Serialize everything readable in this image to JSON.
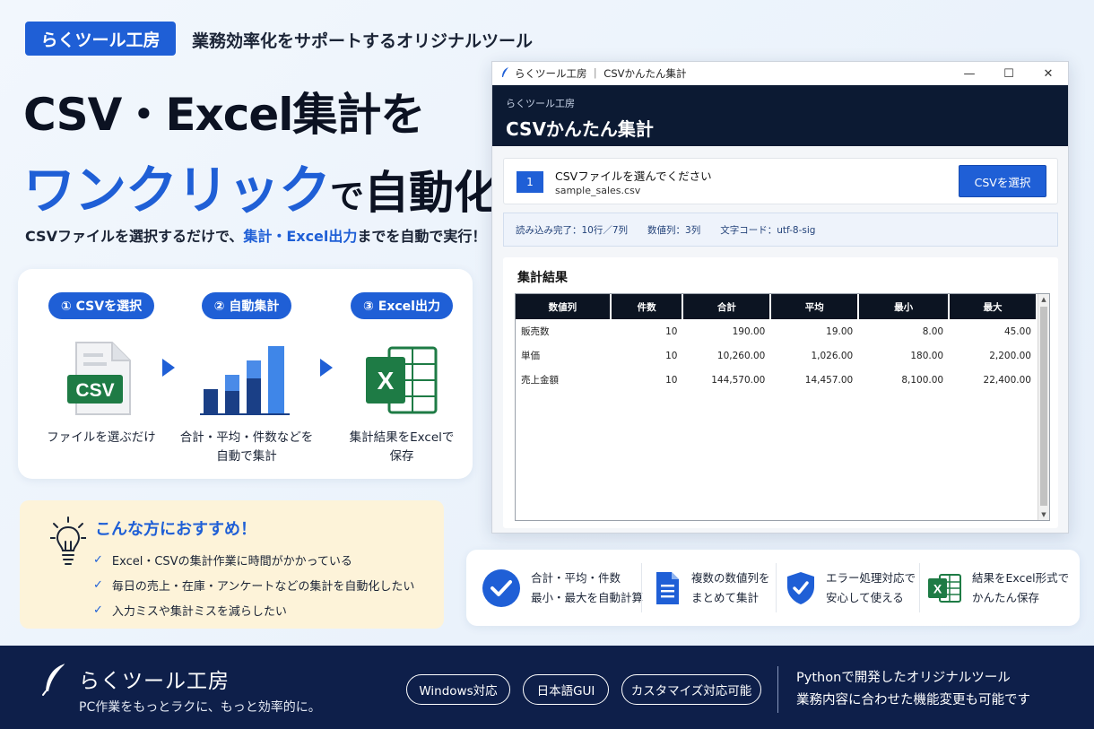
{
  "brand_tag": "らくツール工房",
  "tagline": "業務効率化をサポートするオリジナルツール",
  "hero": {
    "line1": "CSV・Excel集計を",
    "line2_blue": "ワンクリック",
    "line2_de": "で",
    "line2_end": "自動化",
    "sub_before": "CSVファイルを選択するだけで、",
    "sub_highlight": "集計・Excel出力",
    "sub_after": "までを自動で実行！"
  },
  "steps": [
    {
      "badge": "① CSVを選択",
      "icon": "csv-file-icon",
      "icon_text": "CSV",
      "desc": "ファイルを選ぶだけ"
    },
    {
      "badge": "② 自動集計",
      "icon": "bar-chart-icon",
      "desc1": "合計・平均・件数などを",
      "desc2": "自動で集計"
    },
    {
      "badge": "③ Excel出力",
      "icon": "excel-icon",
      "icon_text": "X",
      "desc1": "集計結果をExcelで",
      "desc2": "保存"
    }
  ],
  "recommend": {
    "title": "こんな方におすすめ！",
    "items": [
      "Excel・CSVの集計作業に時間がかかっている",
      "毎日の売上・在庫・アンケートなどの集計を自動化したい",
      "入力ミスや集計ミスを減らしたい"
    ]
  },
  "window": {
    "title": "らくツール工房 ｜ CSVかんたん集計",
    "controls": {
      "minimize": "—",
      "maximize": "☐",
      "close": "✕"
    },
    "header_small": "らくツール工房",
    "header_big": "CSVかんたん集計",
    "step_number": "1",
    "file_label": "CSVファイルを選んでください",
    "file_name": "sample_sales.csv",
    "select_button": "CSVを選択",
    "status": {
      "loaded": "読み込み完了：10行／7列",
      "numeric_cols": "数値列：3列",
      "encoding": "文字コード：utf-8-sig"
    },
    "result_title": "集計結果",
    "table": {
      "headers": [
        "数値列",
        "件数",
        "合計",
        "平均",
        "最小",
        "最大"
      ],
      "rows": [
        [
          "販売数",
          "10",
          "190.00",
          "19.00",
          "8.00",
          "45.00"
        ],
        [
          "単価",
          "10",
          "10,260.00",
          "1,026.00",
          "180.00",
          "2,200.00"
        ],
        [
          "売上金額",
          "10",
          "144,570.00",
          "14,457.00",
          "8,100.00",
          "22,400.00"
        ]
      ]
    }
  },
  "features": [
    {
      "icon": "check-circle-icon",
      "line1": "合計・平均・件数",
      "line2": "最小・最大を自動計算"
    },
    {
      "icon": "document-icon",
      "line1": "複数の数値列を",
      "line2": "まとめて集計"
    },
    {
      "icon": "shield-check-icon",
      "line1": "エラー処理対応で",
      "line2": "安心して使える"
    },
    {
      "icon": "excel-icon",
      "line1": "結果をExcel形式で",
      "line2": "かんたん保存"
    }
  ],
  "footer": {
    "brand": "らくツール工房",
    "slogan": "PC作業をもっとラクに、もっと効率的に。",
    "pills": [
      "Windows対応",
      "日本語GUI",
      "カスタマイズ対応可能"
    ],
    "right_line1": "Pythonで開発したオリジナルツール",
    "right_line2": "業務内容に合わせた機能変更も可能です"
  },
  "colors": {
    "accent": "#1f5fd6",
    "dark_navy": "#0e1f4a",
    "excel_green": "#1e7b45",
    "recommend_bg": "#fdf3d9"
  }
}
